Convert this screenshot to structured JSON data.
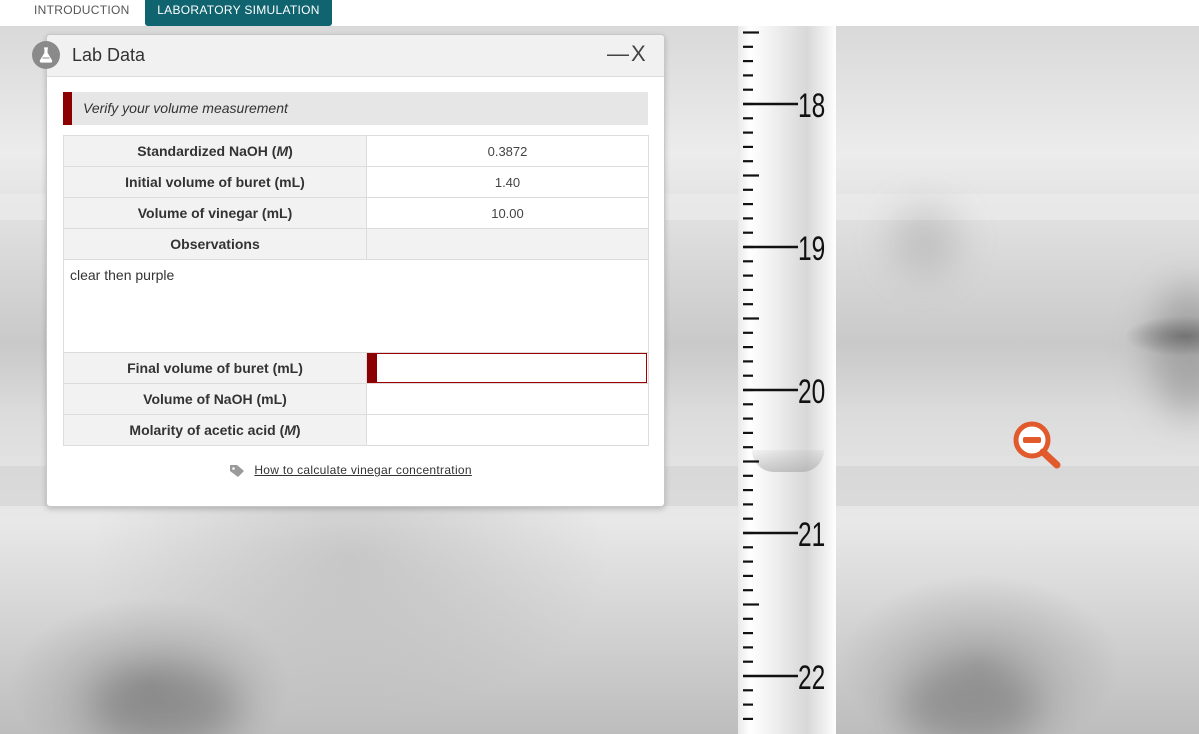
{
  "tabs": [
    {
      "label": "INTRODUCTION",
      "active": false
    },
    {
      "label": "LABORATORY SIMULATION",
      "active": true
    }
  ],
  "colors": {
    "tab_active": "#10646f",
    "accent_red": "#8b0000",
    "zoom_icon": "#e05a2b"
  },
  "panel": {
    "title": "Lab Data",
    "minimize_label": "—",
    "close_label": "X",
    "banner": "Verify your volume measurement",
    "rows": [
      {
        "label": "Standardized NaOH (",
        "unit_italic": "M",
        "suffix": ")",
        "value": "0.3872"
      },
      {
        "label": "Initial volume of buret (mL)",
        "value": "1.40"
      },
      {
        "label": "Volume of vinegar (mL)",
        "value": "10.00"
      },
      {
        "label": "Observations",
        "value": ""
      }
    ],
    "observations_text": "clear then purple",
    "final_volume_label": "Final volume of buret (mL)",
    "final_volume_value": "",
    "naoh_volume_label": "Volume of NaOH (mL)",
    "naoh_volume_value": "",
    "molarity_label_prefix": "Molarity of acetic acid (",
    "molarity_label_unit": "M",
    "molarity_label_suffix": ")",
    "molarity_value": "",
    "help_link": "How to calculate vinegar concentration"
  },
  "buret": {
    "scale_labels": [
      "18",
      "19",
      "20",
      "21",
      "22"
    ]
  },
  "icons": {
    "panel_icon": "flask-icon",
    "zoom": "zoom-out-icon",
    "help": "tag-icon"
  }
}
